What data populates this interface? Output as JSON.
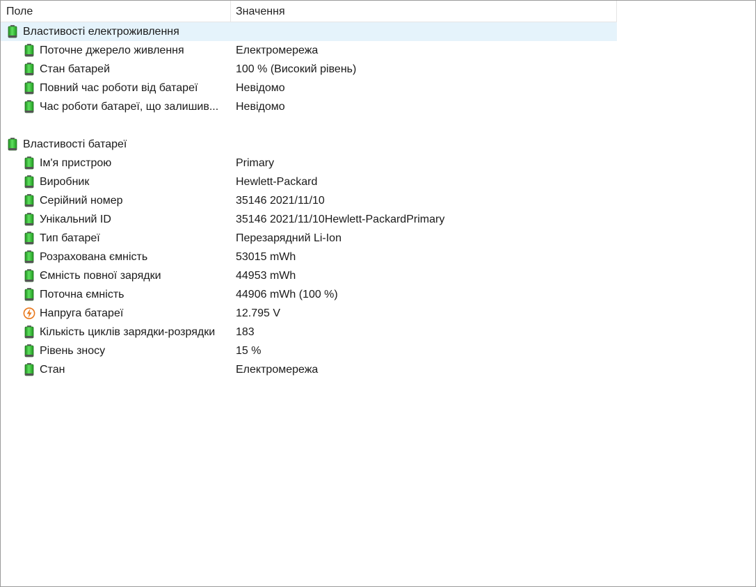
{
  "header": {
    "field": "Поле",
    "value": "Значення"
  },
  "groups": [
    {
      "title": "Властивості електроживлення",
      "items": [
        {
          "field": "Поточне джерело живлення",
          "value": "Електромережа"
        },
        {
          "field": "Стан батарей",
          "value": "100 % (Високий рівень)"
        },
        {
          "field": "Повний час роботи від батареї",
          "value": "Невідомо"
        },
        {
          "field": "Час роботи батареї, що залишив...",
          "value": "Невідомо"
        }
      ]
    },
    {
      "title": "Властивості батареї",
      "items": [
        {
          "field": "Ім'я пристрою",
          "value": "Primary"
        },
        {
          "field": "Виробник",
          "value": "Hewlett-Packard"
        },
        {
          "field": "Серійний номер",
          "value": "35146 2021/11/10"
        },
        {
          "field": "Унікальний ID",
          "value": "35146 2021/11/10Hewlett-PackardPrimary"
        },
        {
          "field": "Тип батареї",
          "value": "Перезарядний Li-Ion"
        },
        {
          "field": "Розрахована ємність",
          "value": "53015 mWh"
        },
        {
          "field": "Ємність повної зарядки",
          "value": "44953 mWh"
        },
        {
          "field": "Поточна ємність",
          "value": "44906 mWh  (100 %)"
        },
        {
          "field": "Напруга батареї",
          "value": "12.795 V"
        },
        {
          "field": "Кількість циклів зарядки-розрядки",
          "value": "183"
        },
        {
          "field": "Рівень зносу",
          "value": "15 %"
        },
        {
          "field": "Стан",
          "value": "Електромережа"
        }
      ]
    }
  ],
  "icons": {
    "battery": "battery-icon",
    "voltage": "voltage-icon"
  },
  "colors": {
    "selected_row": "#e5f3fb",
    "battery_green": "#3cc43c",
    "voltage_orange": "#e8771a"
  }
}
